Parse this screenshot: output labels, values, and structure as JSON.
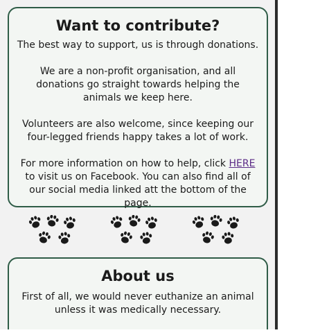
{
  "contribute": {
    "heading": "Want to contribute?",
    "p1": "The best way to support, us is through donations.",
    "p2": "We are a non-profit organisation, and all donations go straight towards helping the animals we keep here.",
    "p3": "Volunteers are also welcome, since keeping our four-legged friends happy takes a lot of work.",
    "p4_before": "For more information on how to help, click ",
    "p4_link": "HERE",
    "p4_after": " to visit us on Facebook. You can also find all of our social media linked att the bottom of the page."
  },
  "divider": {
    "icon": "paw-prints-icon",
    "groups": 3
  },
  "about": {
    "heading": "About us",
    "p1": "First of all, we would never euthanize an animal unless it was medically necessary."
  },
  "colors": {
    "card_border": "#2f5c47",
    "card_background": "#f3f6f3",
    "link": "#5a2a86",
    "page_background": "#f2f2f2"
  }
}
